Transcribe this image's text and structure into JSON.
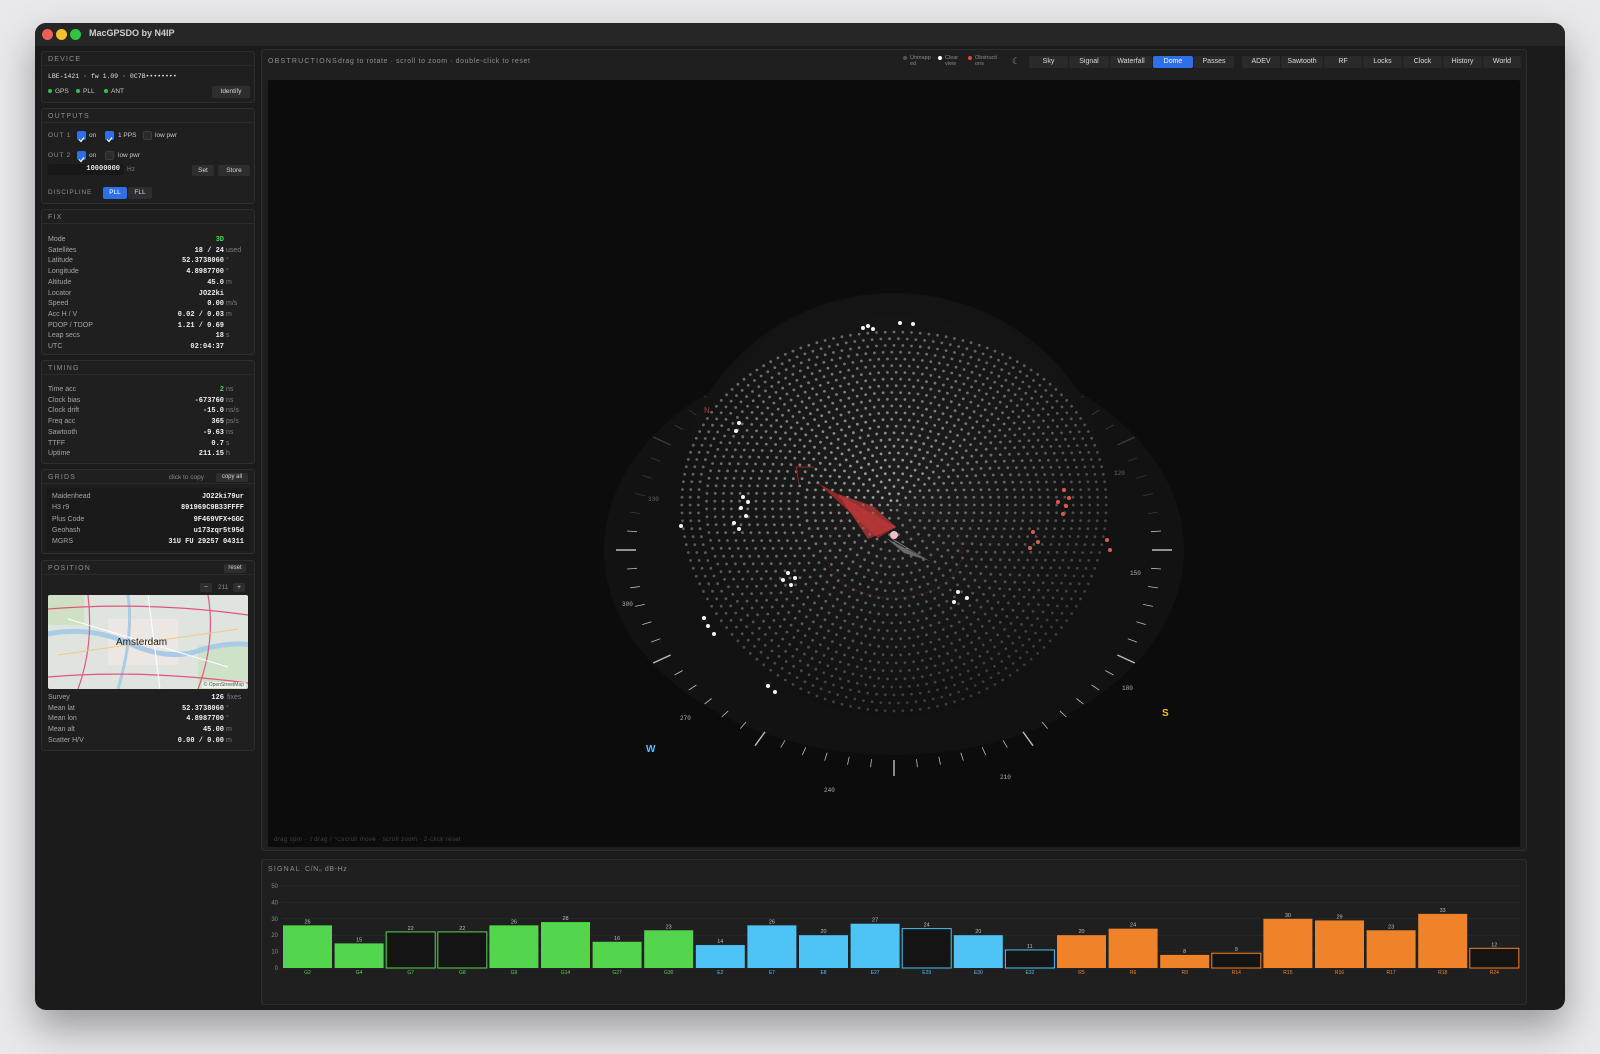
{
  "app": {
    "title": "MacGPSDO by N4IP"
  },
  "device": {
    "head": "DEVICE",
    "id": "LBE-1421 · fw 1.09 · 0C7B••••••••",
    "gps": "GPS",
    "pll": "PLL",
    "ant": "ANT",
    "identify": "Identify"
  },
  "outputs": {
    "head": "OUTPUTS",
    "out1": "OUT 1",
    "out2": "OUT 2",
    "on": "on",
    "pps": "1 PPS",
    "lowpwr": "low pwr",
    "freq": "10000000",
    "hz": "Hz",
    "set": "Set",
    "store": "Store",
    "discipline": "DISCIPLINE",
    "pll": "PLL",
    "fll": "FLL"
  },
  "fix": {
    "head": "FIX",
    "rows": [
      {
        "k": "Mode",
        "v": "3D",
        "u": ""
      },
      {
        "k": "Satellites",
        "v": "18 / 24",
        "u": "used"
      },
      {
        "k": "Latitude",
        "v": "52.3738060",
        "u": "°"
      },
      {
        "k": "Longitude",
        "v": "4.8987700",
        "u": "°"
      },
      {
        "k": "Altitude",
        "v": "45.0",
        "u": "m"
      },
      {
        "k": "Locator",
        "v": "JO22ki",
        "u": ""
      },
      {
        "k": "Speed",
        "v": "0.00",
        "u": "m/s"
      },
      {
        "k": "Acc H / V",
        "v": "0.02 / 0.03",
        "u": "m"
      },
      {
        "k": "PDOP / TDOP",
        "v": "1.21 / 0.69",
        "u": ""
      },
      {
        "k": "Leap secs",
        "v": "18",
        "u": "s"
      },
      {
        "k": "UTC",
        "v": "02:04:37",
        "u": ""
      }
    ]
  },
  "timing": {
    "head": "TIMING",
    "rows": [
      {
        "k": "Time acc",
        "v": "2",
        "u": "ns"
      },
      {
        "k": "Clock bias",
        "v": "-673760",
        "u": "ns"
      },
      {
        "k": "Clock drift",
        "v": "-15.0",
        "u": "ns/s"
      },
      {
        "k": "Freq acc",
        "v": "365",
        "u": "ps/s"
      },
      {
        "k": "Sawtooth",
        "v": "-9.63",
        "u": "ns"
      },
      {
        "k": "TTFF",
        "v": "0.7",
        "u": "s"
      },
      {
        "k": "Uptime",
        "v": "211.15",
        "u": "h"
      }
    ]
  },
  "grids": {
    "head": "GRIDS",
    "hint": "click to copy",
    "copyall": "copy all",
    "rows": [
      {
        "k": "Maidenhead",
        "v": "JO22ki79ur"
      },
      {
        "k": "H3 r9",
        "v": "891969C9B33FFFF"
      },
      {
        "k": "Plus Code",
        "v": "9F469VFX+GGC"
      },
      {
        "k": "Geohash",
        "v": "u173zqr5t95d"
      },
      {
        "k": "MGRS",
        "v": "31U FU 29257 04311"
      }
    ]
  },
  "position": {
    "head": "POSITION",
    "reset": "reset",
    "zoom_minus": "−",
    "zoom": "211",
    "zoom_plus": "+",
    "map_label": "Amsterdam",
    "attribution": "© OpenStreetMap",
    "rows": [
      {
        "k": "Survey",
        "v": "126",
        "u": "fixes"
      },
      {
        "k": "Mean lat",
        "v": "52.3738060",
        "u": "°"
      },
      {
        "k": "Mean lon",
        "v": "4.8987700",
        "u": "°"
      },
      {
        "k": "Mean alt",
        "v": "45.00",
        "u": "m"
      },
      {
        "k": "Scatter H/V",
        "v": "0.00 / 0.00",
        "u": "m"
      }
    ]
  },
  "main": {
    "head": "OBSTRUCTIONS",
    "hint": "drag to rotate · scroll to zoom · double-click to reset",
    "legend": [
      {
        "l1": "Unmapp",
        "l2": "ed",
        "color": "#555555"
      },
      {
        "l1": "Clear",
        "l2": "view",
        "color": "#ffffff"
      },
      {
        "l1": "Obstructi",
        "l2": "ons",
        "color": "#e0463d"
      }
    ],
    "tabs": [
      "Sky",
      "Signal",
      "Waterfall",
      "Dome",
      "Passes",
      "ADEV",
      "Sawtooth",
      "RF",
      "Locks",
      "Clock",
      "History",
      "World"
    ],
    "active_tab": "Dome",
    "footer": "drag spin · ⇧drag / ⌥scroll move · scroll zoom · 2-click reset",
    "compass": {
      "n": "N",
      "s": "S",
      "w": "W"
    },
    "azimuth_labels": [
      "120",
      "150",
      "180",
      "210",
      "240",
      "270",
      "300",
      "330"
    ]
  },
  "signal": {
    "head": "SIGNAL",
    "unit": "C/N₀ dB-Hz",
    "yticks": [
      "50",
      "40",
      "30",
      "20",
      "10",
      "0"
    ],
    "bars": [
      {
        "prn": "G2",
        "v": 26,
        "c": "#53d64d",
        "f": true
      },
      {
        "prn": "G4",
        "v": 15,
        "c": "#53d64d",
        "f": true
      },
      {
        "prn": "G7",
        "v": 22,
        "c": "#53d64d",
        "f": false
      },
      {
        "prn": "G8",
        "v": 22,
        "c": "#53d64d",
        "f": false
      },
      {
        "prn": "G9",
        "v": 26,
        "c": "#53d64d",
        "f": true
      },
      {
        "prn": "G14",
        "v": 28,
        "c": "#53d64d",
        "f": true
      },
      {
        "prn": "G27",
        "v": 16,
        "c": "#53d64d",
        "f": true
      },
      {
        "prn": "G30",
        "v": 23,
        "c": "#53d64d",
        "f": true
      },
      {
        "prn": "E2",
        "v": 14,
        "c": "#4ec3f5",
        "f": true
      },
      {
        "prn": "E7",
        "v": 26,
        "c": "#4ec3f5",
        "f": true
      },
      {
        "prn": "E8",
        "v": 20,
        "c": "#4ec3f5",
        "f": true
      },
      {
        "prn": "E27",
        "v": 27,
        "c": "#4ec3f5",
        "f": true
      },
      {
        "prn": "E29",
        "v": 24,
        "c": "#4ec3f5",
        "f": false
      },
      {
        "prn": "E30",
        "v": 20,
        "c": "#4ec3f5",
        "f": true
      },
      {
        "prn": "E32",
        "v": 11,
        "c": "#4ec3f5",
        "f": false
      },
      {
        "prn": "R5",
        "v": 20,
        "c": "#f0832a",
        "f": true
      },
      {
        "prn": "R6",
        "v": 24,
        "c": "#f0832a",
        "f": true
      },
      {
        "prn": "R9",
        "v": 8,
        "c": "#f0832a",
        "f": true
      },
      {
        "prn": "R14",
        "v": 9,
        "c": "#f0832a",
        "f": false
      },
      {
        "prn": "R15",
        "v": 30,
        "c": "#f0832a",
        "f": true
      },
      {
        "prn": "R16",
        "v": 29,
        "c": "#f0832a",
        "f": true
      },
      {
        "prn": "R17",
        "v": 23,
        "c": "#f0832a",
        "f": true
      },
      {
        "prn": "R18",
        "v": 33,
        "c": "#f0832a",
        "f": true
      },
      {
        "prn": "R24",
        "v": 12,
        "c": "#f0832a",
        "f": false
      }
    ]
  }
}
